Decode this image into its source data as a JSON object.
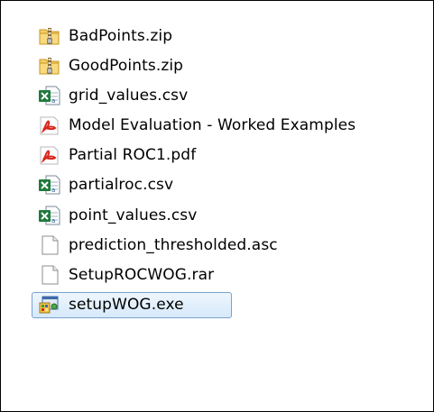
{
  "file_list": {
    "items": [
      {
        "name": "BadPoints.zip",
        "icon": "zip-folder-icon",
        "selected": false
      },
      {
        "name": "GoodPoints.zip",
        "icon": "zip-folder-icon",
        "selected": false
      },
      {
        "name": "grid_values.csv",
        "icon": "excel-csv-icon",
        "selected": false
      },
      {
        "name": "Model Evaluation - Worked Examples",
        "icon": "pdf-icon",
        "selected": false
      },
      {
        "name": "Partial ROC1.pdf",
        "icon": "pdf-icon",
        "selected": false
      },
      {
        "name": "partialroc.csv",
        "icon": "excel-csv-icon",
        "selected": false
      },
      {
        "name": "point_values.csv",
        "icon": "excel-csv-icon",
        "selected": false
      },
      {
        "name": "prediction_thresholded.asc",
        "icon": "generic-file-icon",
        "selected": false
      },
      {
        "name": "SetupROCWOG.rar",
        "icon": "generic-file-icon",
        "selected": false
      },
      {
        "name": "setupWOG.exe",
        "icon": "setup-installer-icon",
        "selected": true
      }
    ]
  },
  "colors": {
    "selection_fill": "#d6e9fb",
    "selection_border": "#7da2ce",
    "zip_folder": "#e8b84a",
    "excel_green": "#1f7a3c",
    "pdf_red": "#d8261c"
  }
}
